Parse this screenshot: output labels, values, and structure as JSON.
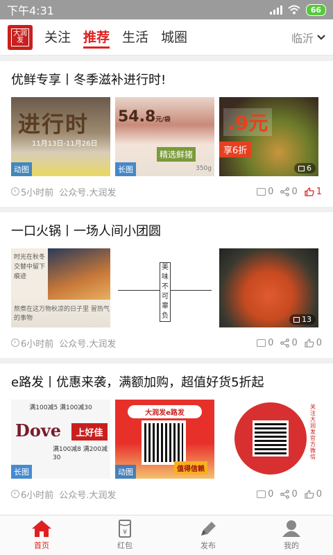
{
  "status_bar": {
    "time": "下午4:31",
    "battery": "66"
  },
  "header": {
    "logo_text": "大润发",
    "tabs": [
      {
        "label": "关注",
        "active": false
      },
      {
        "label": "推荐",
        "active": true
      },
      {
        "label": "生活",
        "active": false
      },
      {
        "label": "城圈",
        "active": false
      }
    ],
    "city": "临沂"
  },
  "posts": [
    {
      "title": "优鲜专享丨冬季滋补进行时!",
      "images": [
        {
          "badge": "动图",
          "art_text": "进行时",
          "art_sub": "11月13日-11月26日"
        },
        {
          "badge": "长图",
          "art_price": "54.8",
          "art_unit": "元/袋",
          "art_tag": "精选鲜猪",
          "art_weight": "350g"
        },
        {
          "count": "6",
          "art_price": ".9元",
          "art_tag": "享6折"
        }
      ],
      "time": "5小时前",
      "source": "公众号.大润发",
      "comments": "0",
      "shares": "0",
      "likes": "1",
      "liked": true
    },
    {
      "title": "一口火锅丨一场人间小团圆",
      "images": [
        {
          "art_lines": "时光在秋冬交替中留下痕迹",
          "art_caption": "熬煮在这万物秋凉的日子里 冒热气的事物"
        },
        {
          "art_vertical": "美味不可辜负"
        },
        {
          "count": "13"
        }
      ],
      "time": "6小时前",
      "source": "公众号.大润发",
      "comments": "0",
      "shares": "0",
      "likes": "0",
      "liked": false
    },
    {
      "title": "e路发丨优惠来袭，满额加购，超值好货5折起",
      "images": [
        {
          "badge": "长图",
          "art_brand": "Dove",
          "art_brand2": "上好佳",
          "art_top": "满100减5   满100减30",
          "art_bottom": "满100减8  满200减30"
        },
        {
          "badge": "动图",
          "art_head": "大润发e路发",
          "art_btn": "值得信赖"
        },
        {
          "art_ring": "关注大润发官方微信"
        }
      ],
      "time": "6小时前",
      "source": "公众号.大润发",
      "comments": "0",
      "shares": "0",
      "likes": "0",
      "liked": false
    }
  ],
  "bottom_nav": [
    {
      "label": "首页",
      "icon": "home-icon",
      "active": true
    },
    {
      "label": "红包",
      "icon": "red-packet-icon",
      "active": false
    },
    {
      "label": "发布",
      "icon": "pen-icon",
      "active": false
    },
    {
      "label": "我的",
      "icon": "user-icon",
      "active": false
    }
  ],
  "colors": {
    "accent": "#e02020",
    "status_bar": "#9b9b9b",
    "battery": "#56c93a"
  }
}
